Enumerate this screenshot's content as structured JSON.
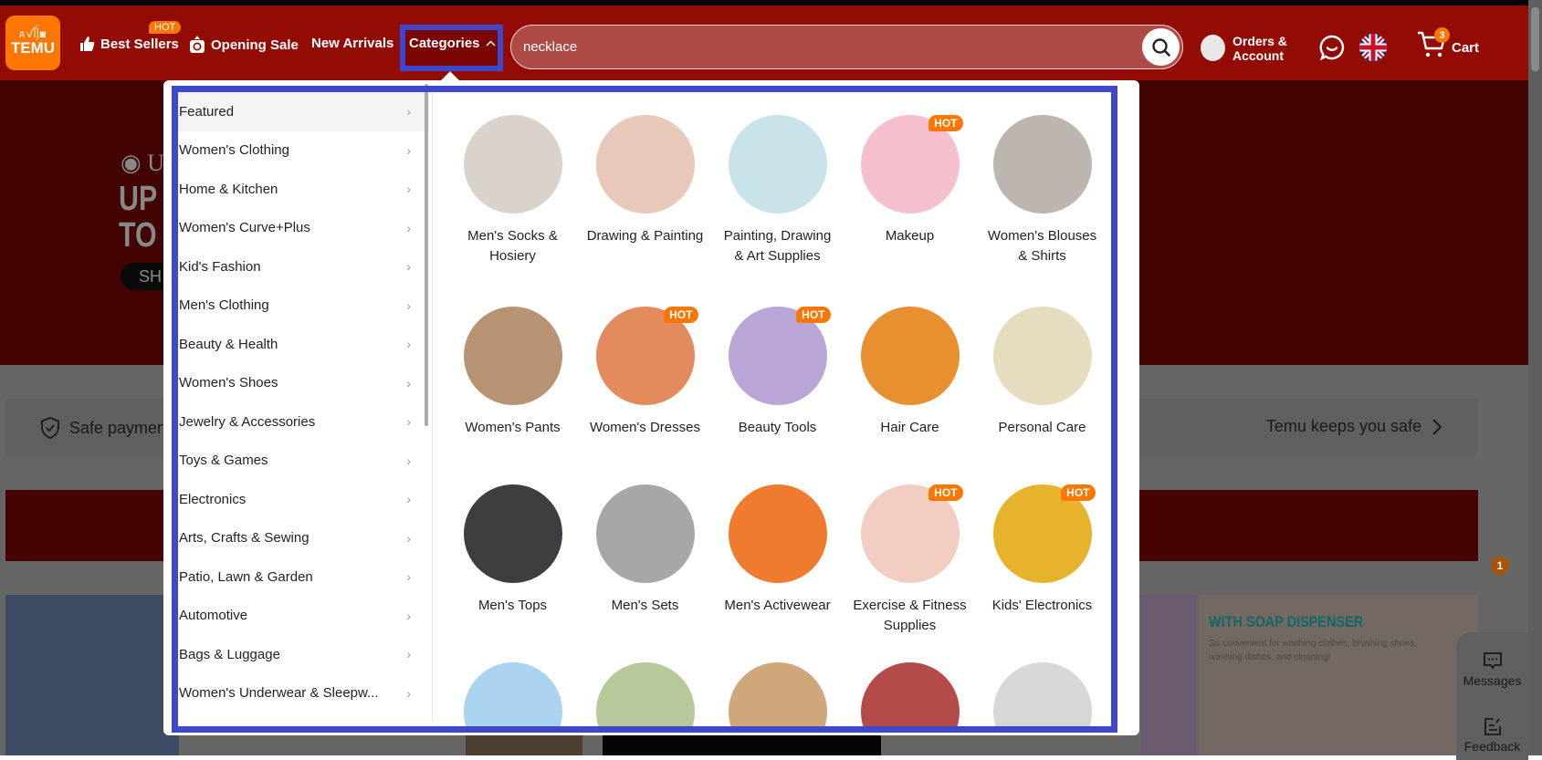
{
  "header": {
    "logo_text": "TEMU",
    "logo_glyphs": "ጰꪜᥦ◙",
    "nav": [
      {
        "label": "Best Sellers",
        "icon": "thumbs-up-icon",
        "badge": "HOT"
      },
      {
        "label": "Opening Sale",
        "icon": "alarm-clock-icon"
      },
      {
        "label": "New Arrivals"
      },
      {
        "label": "Categories",
        "icon": "chevron-up-icon",
        "expanded": true
      }
    ],
    "search": {
      "value": "necklace",
      "icon": "search-icon"
    },
    "account": {
      "line1": "Orders &",
      "line2": "Account"
    },
    "support_icon": "chat-smile-icon",
    "language_icon": "uk-flag-icon",
    "cart": {
      "label": "Cart",
      "count": "3"
    }
  },
  "background": {
    "hero": {
      "location": "UK",
      "headline_1": "UP",
      "headline_2": "TO",
      "button": "SH"
    },
    "safe_payment": "Safe payment",
    "keeps_safe": "Temu keeps you safe",
    "soap_title": "WITH SOAP DISPENSER",
    "soap_subtitle": "So convenient for washing clothes, brushing shoes, washing dishes, and cleaning!",
    "messages": {
      "label": "Messages",
      "count": "1"
    },
    "feedback": {
      "label": "Feedback"
    }
  },
  "categories": {
    "selected": "Featured",
    "items": [
      "Featured",
      "Women's Clothing",
      "Home & Kitchen",
      "Women's Curve+Plus",
      "Kid's Fashion",
      "Men's Clothing",
      "Beauty & Health",
      "Women's Shoes",
      "Jewelry & Accessories",
      "Toys & Games",
      "Electronics",
      "Arts, Crafts & Sewing",
      "Patio, Lawn & Garden",
      "Automotive",
      "Bags & Luggage",
      "Women's Underwear & Sleepw..."
    ],
    "subcategories": [
      {
        "label": "Men's Socks & Hosiery",
        "hot": false,
        "color": "#d9d3cc"
      },
      {
        "label": "Drawing & Painting",
        "hot": false,
        "color": "#e8c8b8"
      },
      {
        "label": "Painting, Drawing & Art Supplies",
        "hot": false,
        "color": "#c9e3ea"
      },
      {
        "label": "Makeup",
        "hot": true,
        "color": "#f6bfcd"
      },
      {
        "label": "Women's Blouses & Shirts",
        "hot": false,
        "color": "#bdb6b0"
      },
      {
        "label": "Women's Pants",
        "hot": false,
        "color": "#b89372"
      },
      {
        "label": "Women's Dresses",
        "hot": true,
        "color": "#e48b5e"
      },
      {
        "label": "Beauty Tools",
        "hot": true,
        "color": "#b9a6d6"
      },
      {
        "label": "Hair Care",
        "hot": false,
        "color": "#e8902f"
      },
      {
        "label": "Personal Care",
        "hot": false,
        "color": "#e6dcc0"
      },
      {
        "label": "Men's Tops",
        "hot": false,
        "color": "#3e3e40"
      },
      {
        "label": "Men's Sets",
        "hot": false,
        "color": "#a7a7a7"
      },
      {
        "label": "Men's Activewear",
        "hot": false,
        "color": "#f07a2e"
      },
      {
        "label": "Exercise & Fitness Supplies",
        "hot": true,
        "color": "#f1cdc2"
      },
      {
        "label": "Kids' Electronics",
        "hot": true,
        "color": "#e8b32c"
      },
      {
        "label": "",
        "hot": false,
        "color": "#a9d3ef"
      },
      {
        "label": "",
        "hot": false,
        "color": "#b7c99a"
      },
      {
        "label": "",
        "hot": false,
        "color": "#cfa77a"
      },
      {
        "label": "",
        "hot": false,
        "color": "#b54a4a"
      },
      {
        "label": "",
        "hot": false,
        "color": "#d7d7d7"
      }
    ],
    "hot_label": "HOT"
  }
}
